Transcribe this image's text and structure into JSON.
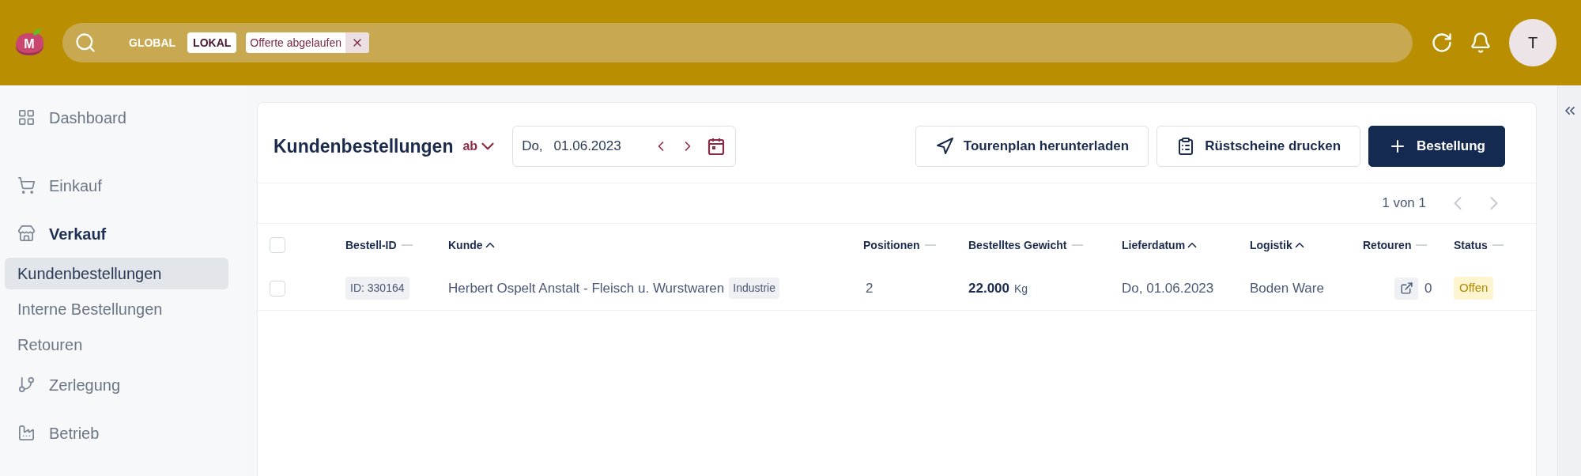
{
  "topbar": {
    "logo": {
      "text": "M"
    },
    "search": {
      "scopes": [
        {
          "label": "GLOBAL",
          "selected": false
        },
        {
          "label": "LOKAL",
          "selected": true
        }
      ],
      "filters": [
        {
          "label": "Offerte abgelaufen"
        }
      ]
    },
    "avatar": {
      "initial": "T"
    }
  },
  "sidebar": {
    "items": [
      {
        "label": "Dashboard",
        "expanded": false
      },
      {
        "label": "Einkauf",
        "expanded": false
      },
      {
        "label": "Verkauf",
        "expanded": true,
        "children": [
          {
            "label": "Kundenbestellungen",
            "selected": true
          },
          {
            "label": "Interne Bestellungen",
            "selected": false
          },
          {
            "label": "Retouren",
            "selected": false
          }
        ]
      },
      {
        "label": "Zerlegung",
        "expanded": false
      },
      {
        "label": "Betrieb",
        "expanded": false
      }
    ]
  },
  "page": {
    "title": "Kundenbestellungen",
    "date_mode": "ab",
    "date_picker": {
      "weekday": "Do,",
      "date": "01.06.2023"
    },
    "actions": [
      {
        "label": "Tourenplan herunterladen",
        "kind": "outline"
      },
      {
        "label": "Rüstscheine drucken",
        "kind": "outline"
      },
      {
        "label": "Bestellung",
        "kind": "primary"
      }
    ],
    "pagination": {
      "label": "1 von 1",
      "previous": {
        "disabled": true
      },
      "next": {
        "disabled": true
      }
    }
  },
  "table": {
    "select_all": {
      "checked": false
    },
    "columns": [
      {
        "label": "Bestell-ID",
        "sorted": false
      },
      {
        "label": "Kunde",
        "sorted": true
      },
      {
        "label": "Positionen",
        "sorted": false
      },
      {
        "label": "Bestelltes Gewicht",
        "sorted": false
      },
      {
        "label": "Lieferdatum",
        "sorted": true
      },
      {
        "label": "Logistik",
        "sorted": true
      },
      {
        "label": "Retouren",
        "sorted": false
      },
      {
        "label": "Status",
        "sorted": false
      }
    ],
    "rows": [
      {
        "checked": false,
        "order_id": "ID: 330164",
        "customer": "Herbert Ospelt Anstalt - Fleisch u. Wurstwaren",
        "customer_type": "Industrie",
        "positions": "2",
        "weight": "22.000",
        "weight_unit": "Kg",
        "delivery_date": "Do, 01.06.2023",
        "logistics": "Boden Ware",
        "returns": "0",
        "status": "Offen"
      }
    ]
  }
}
